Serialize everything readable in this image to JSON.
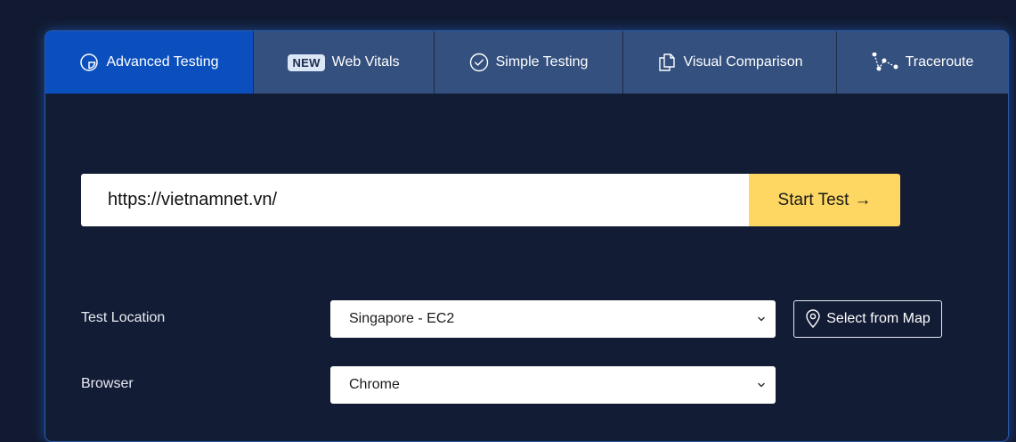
{
  "tabs": [
    {
      "label": "Advanced Testing",
      "icon": "gauge-icon",
      "active": true
    },
    {
      "label": "Web Vitals",
      "icon": "new-badge",
      "badge": "NEW",
      "active": false
    },
    {
      "label": "Simple Testing",
      "icon": "check-circle-icon",
      "active": false
    },
    {
      "label": "Visual Comparison",
      "icon": "copy-documents-icon",
      "active": false
    },
    {
      "label": "Traceroute",
      "icon": "route-nodes-icon",
      "active": false
    }
  ],
  "url_input": {
    "value": "https://vietnamnet.vn/"
  },
  "start_button": {
    "label": "Start Test",
    "arrow": "→"
  },
  "test_location": {
    "label": "Test Location",
    "selected": "Singapore - EC2"
  },
  "map_button": {
    "label": "Select from Map",
    "icon": "map-pin-icon"
  },
  "browser": {
    "label": "Browser",
    "selected": "Chrome"
  },
  "colors": {
    "page_bg": "#111a30",
    "panel_bg": "#131c35",
    "tab_bg": "#34507e",
    "tab_active_bg": "#0b4fbf",
    "start_button_bg": "#fdd762",
    "panel_glow": "#2a5aa8"
  }
}
